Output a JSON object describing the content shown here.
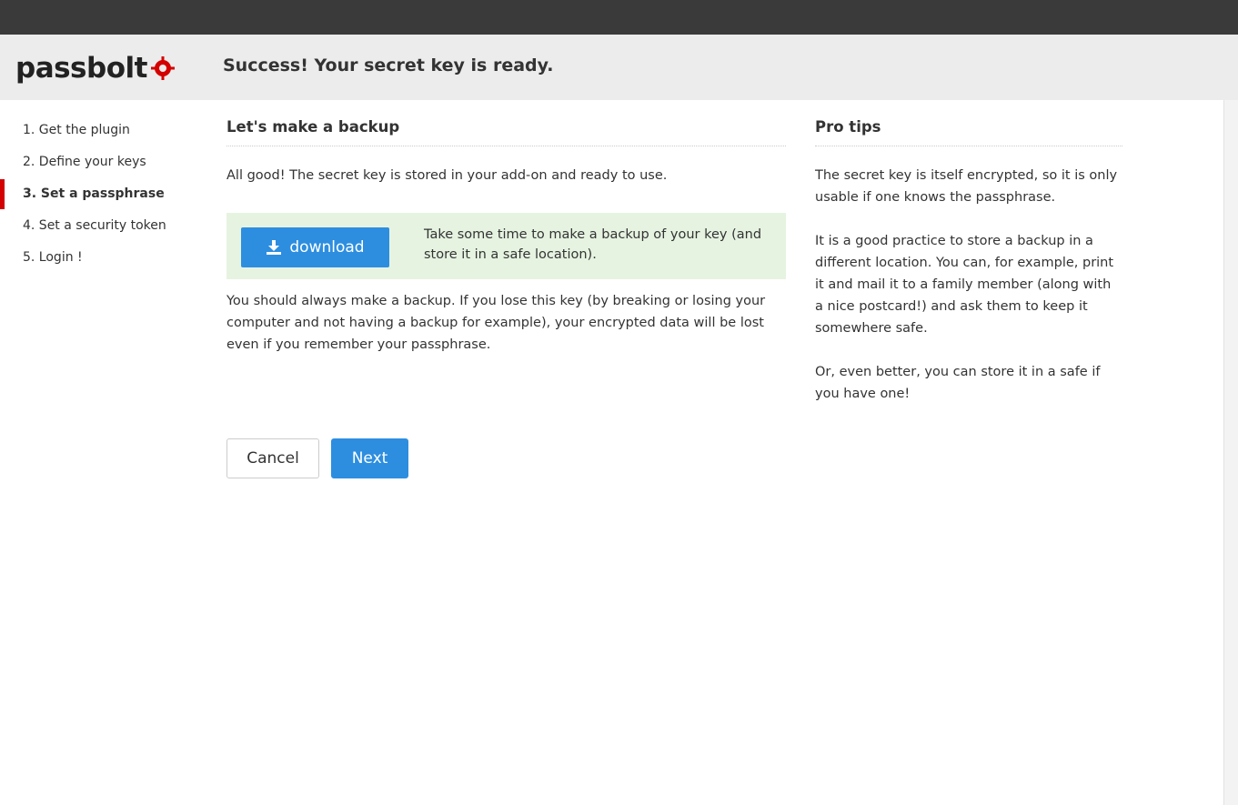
{
  "header": {
    "logo_text": "passbolt",
    "title": "Success! Your secret key is ready."
  },
  "steps": [
    {
      "label": "1. Get the plugin",
      "active": false
    },
    {
      "label": "2. Define your keys",
      "active": false
    },
    {
      "label": "3. Set a passphrase",
      "active": true
    },
    {
      "label": "4. Set a security token",
      "active": false
    },
    {
      "label": "5. Login !",
      "active": false
    }
  ],
  "main": {
    "title": "Let's make a backup",
    "intro": "All good! The secret key is stored in your add-on and ready to use.",
    "download_label": "download",
    "backup_hint": "Take some time to make a backup of your key (and store it in a safe location).",
    "warning": "You should always make a backup. If you lose this key (by breaking or losing your computer and not having a backup for example), your encrypted data will be lost even if you remember your passphrase.",
    "cancel_label": "Cancel",
    "next_label": "Next"
  },
  "tips": {
    "title": "Pro tips",
    "items": [
      "The secret key is itself encrypted, so it is only usable if one knows the passphrase.",
      "It is a good practice to store a backup in a different location. You can, for example, print it and mail it to a family member (along with a nice postcard!) and ask them to keep it somewhere safe.",
      "Or, even better, you can store it in a safe if you have one!"
    ]
  },
  "colors": {
    "accent": "#2d8ee0",
    "brand_red": "#d40101",
    "success_bg": "#e6f3e1",
    "topbar": "#3a3a3a",
    "header_bg": "#ececec"
  },
  "icons": {
    "download": "download-icon",
    "logo_mark": "passbolt-logo-mark"
  }
}
